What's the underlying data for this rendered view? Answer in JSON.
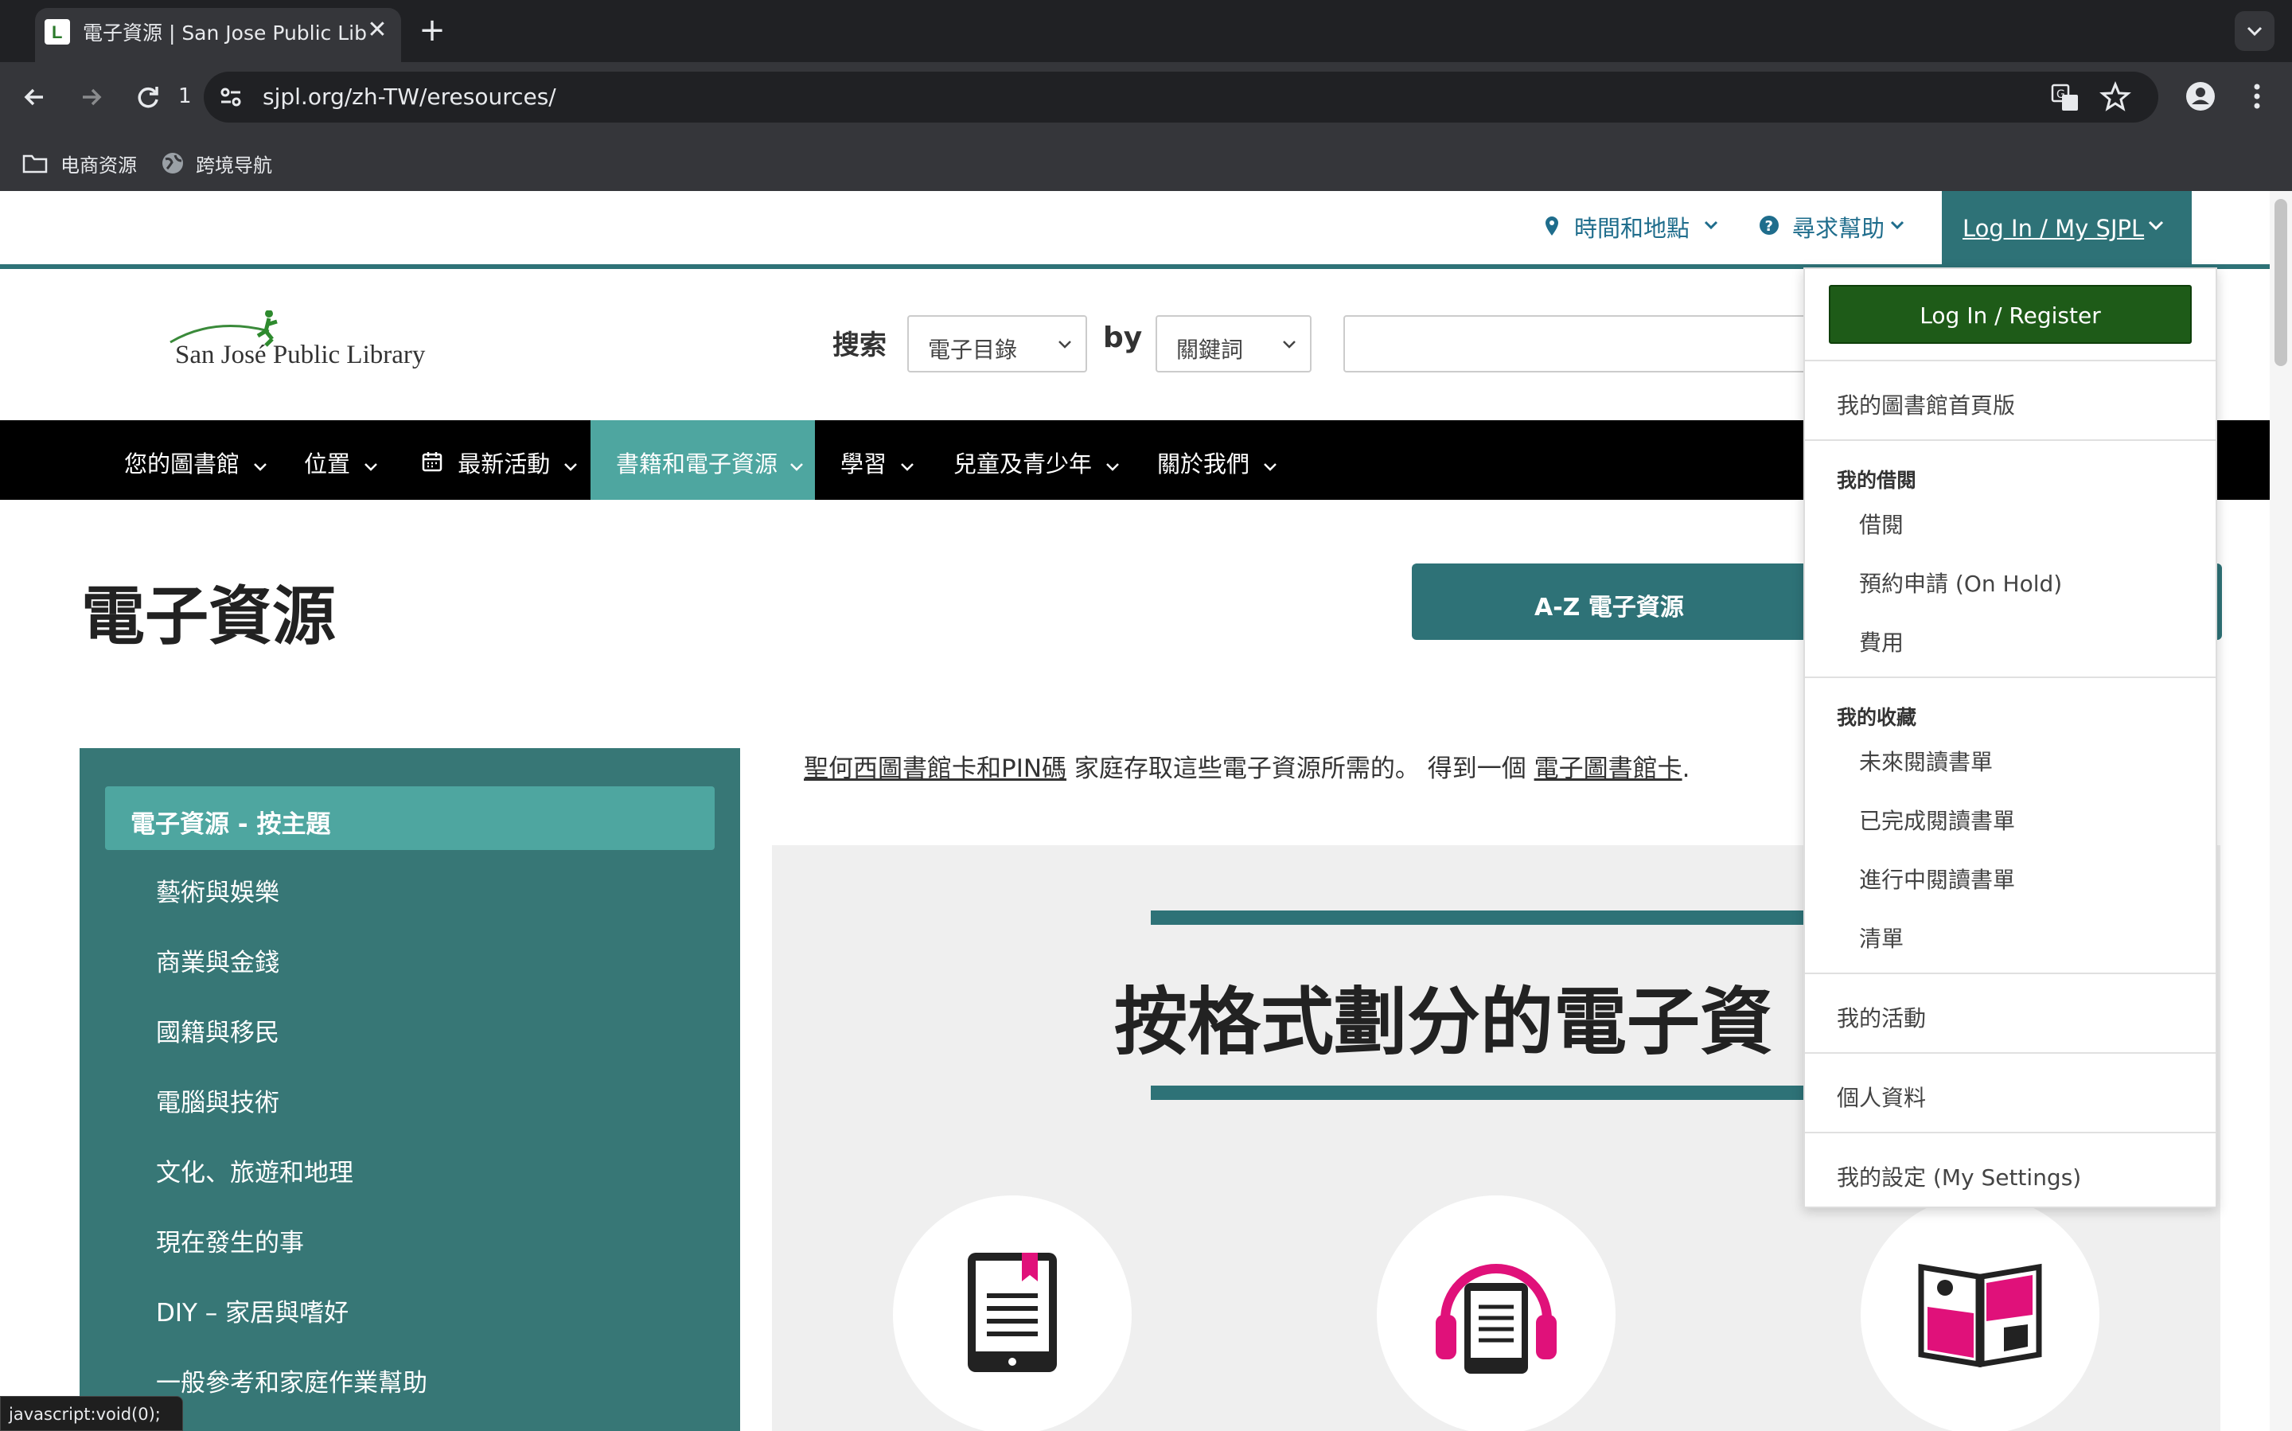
{
  "browser": {
    "tab_title": "電子資源 | San Jose Public Lib",
    "tab_close": "✕",
    "new_tab": "+",
    "reload_badge": "1",
    "url": "sjpl.org/zh-TW/eresources/",
    "bookmarks": [
      {
        "label": "电商资源",
        "icon": "folder-icon"
      },
      {
        "label": "跨境导航",
        "icon": "globe-icon"
      }
    ],
    "status_bar": "javascript:void(0);"
  },
  "utility_nav": {
    "hours_locations": "時間和地點",
    "get_help": "尋求幫助",
    "login": "Log In / My SJPL"
  },
  "header": {
    "logo_text": "San José Public Library",
    "search_label": "搜索",
    "search_scope": "電子目錄",
    "by_label": "by",
    "search_type": "關鍵詞"
  },
  "main_nav": [
    {
      "label": "您的圖書館"
    },
    {
      "label": "位置"
    },
    {
      "label": "最新活動"
    },
    {
      "label": "書籍和電子資源",
      "active": true
    },
    {
      "label": "學習"
    },
    {
      "label": "兒童及青少年"
    },
    {
      "label": "關於我們"
    }
  ],
  "page": {
    "title": "電子資源",
    "az_button": "A-Z 電子資源",
    "intro_link1": "聖何西圖書館卡和PIN碼",
    "intro_text": " 家庭存取這些電子資源所需的。 得到一個 ",
    "intro_link2": "電子圖書館卡",
    "intro_end": ".",
    "format_title": "按格式劃分的電子資"
  },
  "sidebar": {
    "active": "電子資源 - 按主題",
    "items": [
      "藝術與娛樂",
      "商業與金錢",
      "國籍與移民",
      "電腦與技術",
      "文化、旅遊和地理",
      "現在發生的事",
      "DIY – 家居與嗜好",
      "一般參考和家庭作業幫助"
    ]
  },
  "dropdown": {
    "login_register": "Log In / Register",
    "my_home": "我的圖書館首頁版",
    "borrowing_header": "我的借閱",
    "checkouts": "借閱",
    "holds": "預約申請 (On Hold)",
    "fees": "費用",
    "collections_header": "我的收藏",
    "for_later": "未來閱讀書單",
    "completed": "已完成閱讀書單",
    "in_progress": "進行中閱讀書單",
    "lists": "清單",
    "my_events": "我的活動",
    "profile": "個人資料",
    "settings": "我的設定 (My Settings)"
  },
  "colors": {
    "teal": "#2e7277",
    "teal_light": "#4ea6a0",
    "login_green": "#1e5b18",
    "pink": "#e0117a"
  }
}
